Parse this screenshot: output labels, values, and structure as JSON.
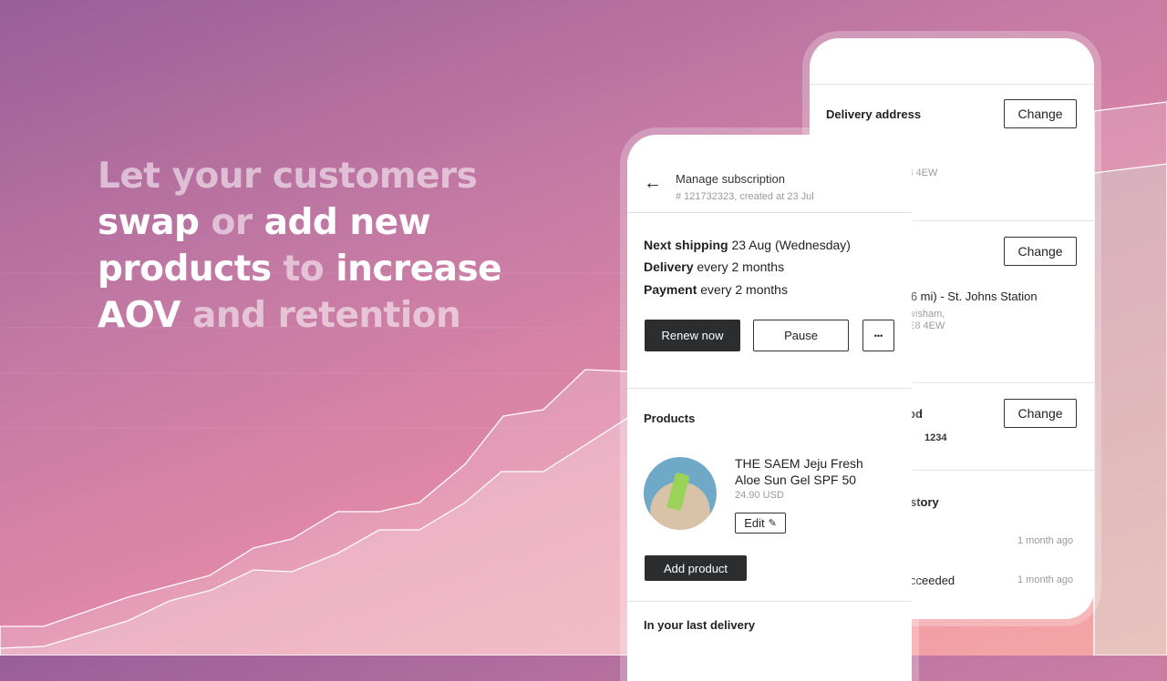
{
  "headline": {
    "l1": "Let your customers",
    "l2a": "swap",
    "l2b": " or ",
    "l2c": "add new",
    "l3a": "products",
    "l3b": " to ",
    "l3c": "increase",
    "l4a": "AOV",
    "l4b": " and retention"
  },
  "back_phone": {
    "delivery_address_title": "Delivery address",
    "change": "Change",
    "address_fragment": "E8 4EW",
    "pickup_line": "0.6 mi) - St. Johns Station",
    "pickup_addr1": "wisham,",
    "pickup_addr2": "E8 4EW",
    "payment_title_fragment": "od",
    "card_fragment": "1234",
    "history_title_fragment": "story",
    "history_time1": "1 month ago",
    "history_item2": "cceeded",
    "history_time2": "1 month ago"
  },
  "front_phone": {
    "title": "Manage subscription",
    "subtitle": "# 121732323, created at 23 Jul",
    "next_shipping_label": "Next shipping",
    "next_shipping_value": " 23 Aug (Wednesday)",
    "delivery_label": "Delivery",
    "delivery_value": " every 2 months",
    "payment_label": "Payment",
    "payment_value": " every 2 months",
    "renew": "Renew now",
    "pause": "Pause",
    "more": "•••",
    "products_title": "Products",
    "product_name": "THE SAEM Jeju Fresh Aloe Sun Gel SPF 50",
    "product_price": "24.90 USD",
    "edit": "Edit",
    "add_product": "Add product",
    "last_delivery": "In your last delivery"
  }
}
